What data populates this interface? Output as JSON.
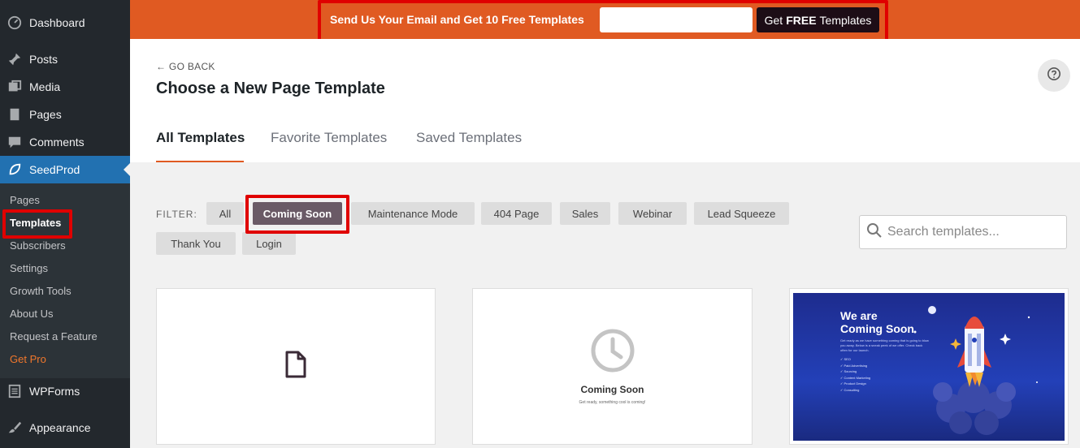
{
  "sidebar": {
    "items": [
      {
        "label": "Dashboard",
        "icon": "dashboard-icon"
      },
      {
        "label": "Posts",
        "icon": "pin-icon"
      },
      {
        "label": "Media",
        "icon": "media-icon"
      },
      {
        "label": "Pages",
        "icon": "page-icon"
      },
      {
        "label": "Comments",
        "icon": "comment-icon"
      },
      {
        "label": "SeedProd",
        "icon": "seedprod-leaf-icon"
      },
      {
        "label": "WPForms",
        "icon": "form-icon"
      },
      {
        "label": "Appearance",
        "icon": "brush-icon"
      }
    ],
    "submenu": [
      "Pages",
      "Templates",
      "Subscribers",
      "Settings",
      "Growth Tools",
      "About Us",
      "Request a Feature",
      "Get Pro"
    ]
  },
  "banner": {
    "text": "Send Us Your Email and Get 10 Free Templates",
    "button_pre": "Get",
    "button_bold": "FREE",
    "button_post": "Templates"
  },
  "header": {
    "go_back": "← GO BACK",
    "title": "Choose a New Page Template"
  },
  "tabs": [
    "All Templates",
    "Favorite Templates",
    "Saved Templates"
  ],
  "filter": {
    "label": "FILTER:",
    "chips": [
      "All",
      "Coming Soon",
      "Maintenance Mode",
      "404 Page",
      "Sales",
      "Webinar",
      "Lead Squeeze",
      "Thank You",
      "Login"
    ],
    "selected": "Coming Soon"
  },
  "search": {
    "placeholder": "Search templates..."
  },
  "cards": {
    "coming_soon_title": "Coming Soon",
    "coming_soon_sub": "Get ready, something cool is coming!",
    "promo_title_1": "We are",
    "promo_title_2": "Coming Soon",
    "promo_desc": "Get ready as we have something coming that is going to blow you away. Below is a sneak peek of we offer. Check back often for our launch.",
    "promo_list": [
      "SEO",
      "Paid Advertising",
      "Sourcing",
      "Content Marketing",
      "Product Design",
      "Consulting"
    ]
  },
  "colors": {
    "accent": "#e05a22",
    "sidebar_bg": "#23282d",
    "active_menu": "#2271b1",
    "highlight_red": "#e00000"
  }
}
